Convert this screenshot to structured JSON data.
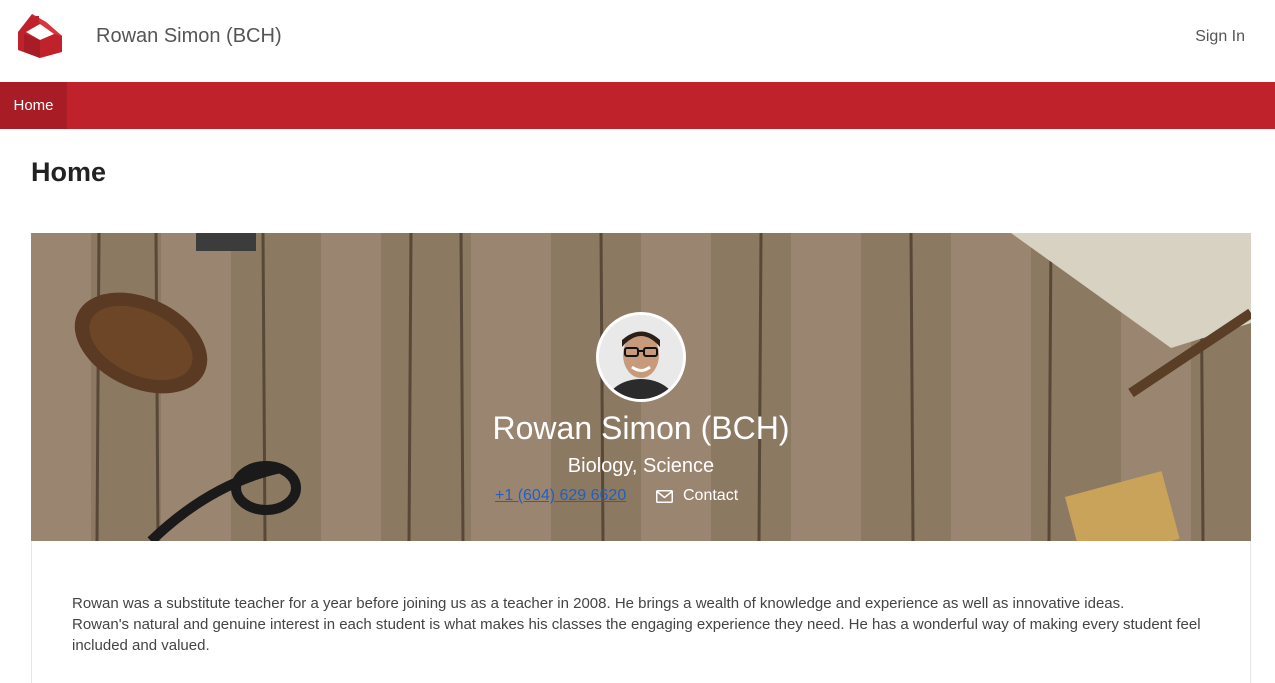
{
  "header": {
    "site_title": "Rowan Simon (BCH)",
    "signin_label": "Sign In"
  },
  "nav": {
    "items": [
      {
        "label": "Home"
      }
    ]
  },
  "page": {
    "heading": "Home"
  },
  "profile": {
    "name": "Rowan Simon (BCH)",
    "subjects": "Biology, Science",
    "phone": "+1 (604) 629 6620",
    "contact_label": "Contact"
  },
  "bio": {
    "paragraphs": [
      "Rowan was a substitute teacher for a year before joining us as a teacher in 2008. He brings a wealth of knowledge and experience as well as innovative ideas.",
      "Rowan's natural and genuine interest in each student is what makes his classes the engaging experience they need. He has a wonderful way of making every student feel included and valued."
    ]
  },
  "colors": {
    "brand_red": "#c0222c",
    "nav_active": "#a81c25",
    "link_blue": "#1e5fc8"
  },
  "icons": {
    "logo": "red-schoolhouse-icon",
    "contact": "envelope-icon"
  }
}
